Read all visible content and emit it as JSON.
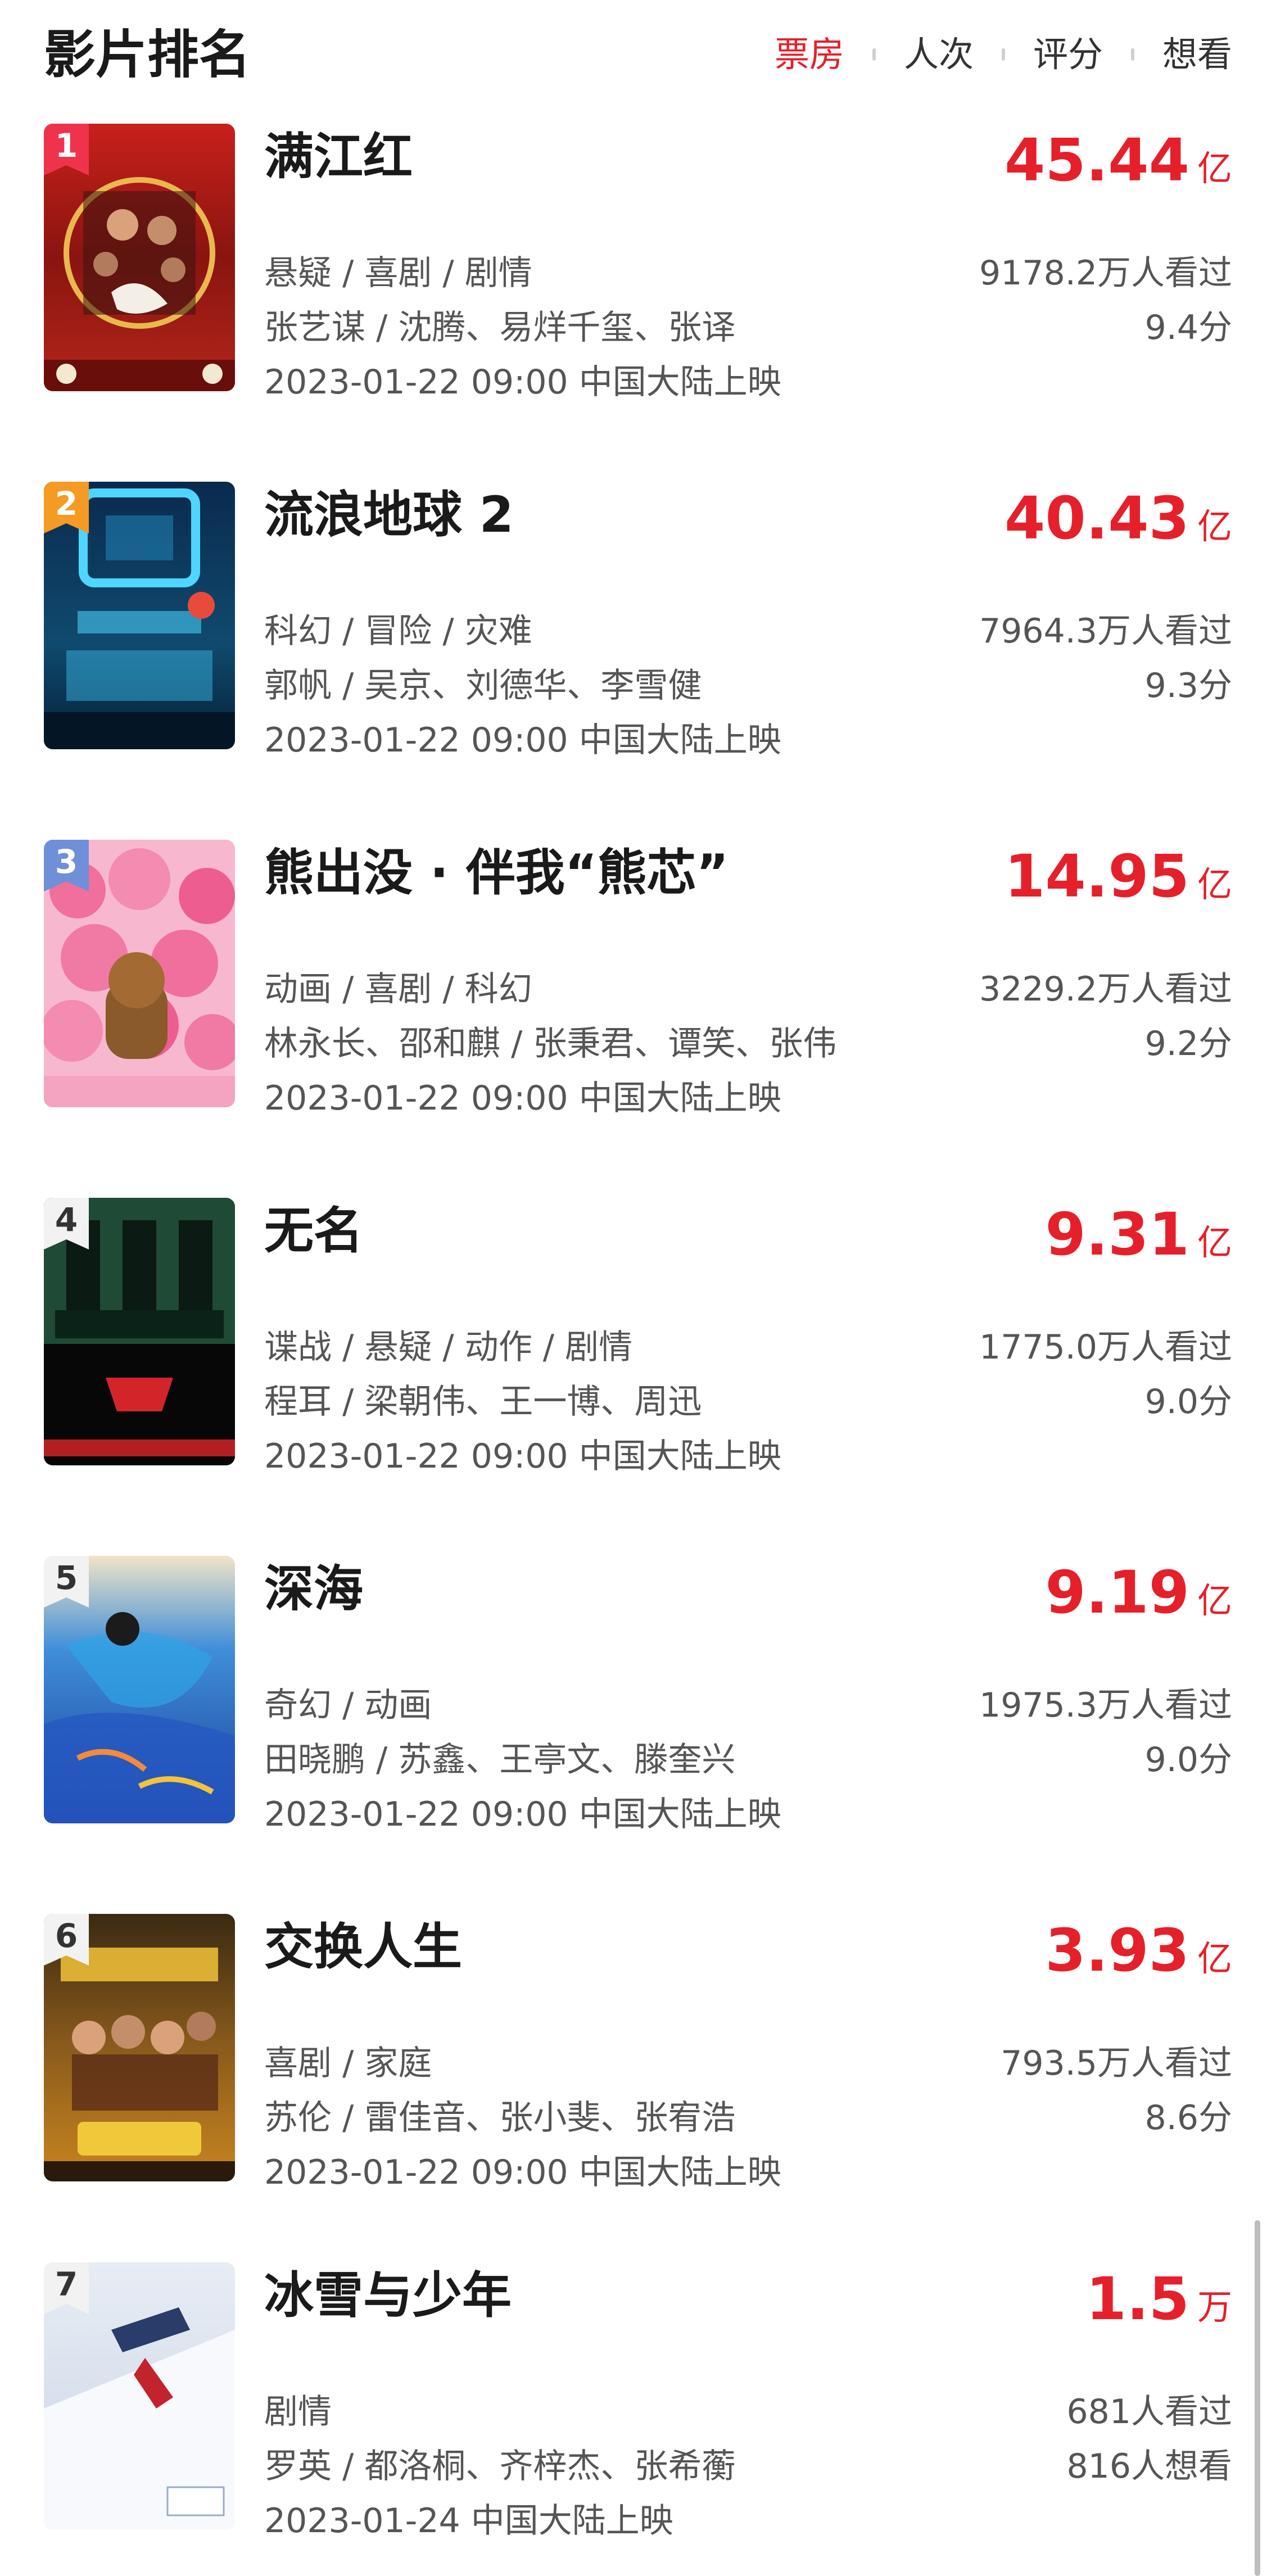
{
  "header": {
    "title": "影片排名",
    "tabs": [
      {
        "label": "票房",
        "active": true
      },
      {
        "label": "人次",
        "active": false
      },
      {
        "label": "评分",
        "active": false
      },
      {
        "label": "想看",
        "active": false
      }
    ]
  },
  "colors": {
    "accent": "#e5202a",
    "rank1": "#f0334d",
    "rank2": "#f59a23",
    "rank3": "#6f8fd8",
    "rank_plain": "#f2f2f2"
  },
  "movies": [
    {
      "rank": "1",
      "title": "满江红",
      "box_value": "45.44",
      "box_unit": "亿",
      "genres": "悬疑 / 喜剧 / 剧情",
      "people": "张艺谋 / 沈腾、易烊千玺、张译",
      "release": "2023-01-22 09:00 中国大陆上映",
      "stat1": "9178.2万人看过",
      "stat2": "9.4分"
    },
    {
      "rank": "2",
      "title": "流浪地球 2",
      "box_value": "40.43",
      "box_unit": "亿",
      "genres": "科幻 / 冒险 / 灾难",
      "people": "郭帆 / 吴京、刘德华、李雪健",
      "release": "2023-01-22 09:00 中国大陆上映",
      "stat1": "7964.3万人看过",
      "stat2": "9.3分"
    },
    {
      "rank": "3",
      "title": "熊出没 · 伴我“熊芯”",
      "box_value": "14.95",
      "box_unit": "亿",
      "genres": "动画 / 喜剧 / 科幻",
      "people": "林永长、邵和麒 / 张秉君、谭笑、张伟",
      "release": "2023-01-22 09:00 中国大陆上映",
      "stat1": "3229.2万人看过",
      "stat2": "9.2分"
    },
    {
      "rank": "4",
      "title": "无名",
      "box_value": "9.31",
      "box_unit": "亿",
      "genres": "谍战 / 悬疑 / 动作 / 剧情",
      "people": "程耳 / 梁朝伟、王一博、周迅",
      "release": "2023-01-22 09:00 中国大陆上映",
      "stat1": "1775.0万人看过",
      "stat2": "9.0分"
    },
    {
      "rank": "5",
      "title": "深海",
      "box_value": "9.19",
      "box_unit": "亿",
      "genres": "奇幻 / 动画",
      "people": "田晓鹏 / 苏鑫、王亭文、滕奎兴",
      "release": "2023-01-22 09:00 中国大陆上映",
      "stat1": "1975.3万人看过",
      "stat2": "9.0分"
    },
    {
      "rank": "6",
      "title": "交换人生",
      "box_value": "3.93",
      "box_unit": "亿",
      "genres": "喜剧 / 家庭",
      "people": "苏伦 / 雷佳音、张小斐、张宥浩",
      "release": "2023-01-22 09:00 中国大陆上映",
      "stat1": "793.5万人看过",
      "stat2": "8.6分"
    },
    {
      "rank": "7",
      "title": "冰雪与少年",
      "box_value": "1.5",
      "box_unit": "万",
      "genres": "剧情",
      "people": "罗英 / 都洛桐、齐梓杰、张希蘅",
      "release": "2023-01-24 中国大陆上映",
      "stat1": "681人看过",
      "stat2": "816人想看"
    }
  ]
}
